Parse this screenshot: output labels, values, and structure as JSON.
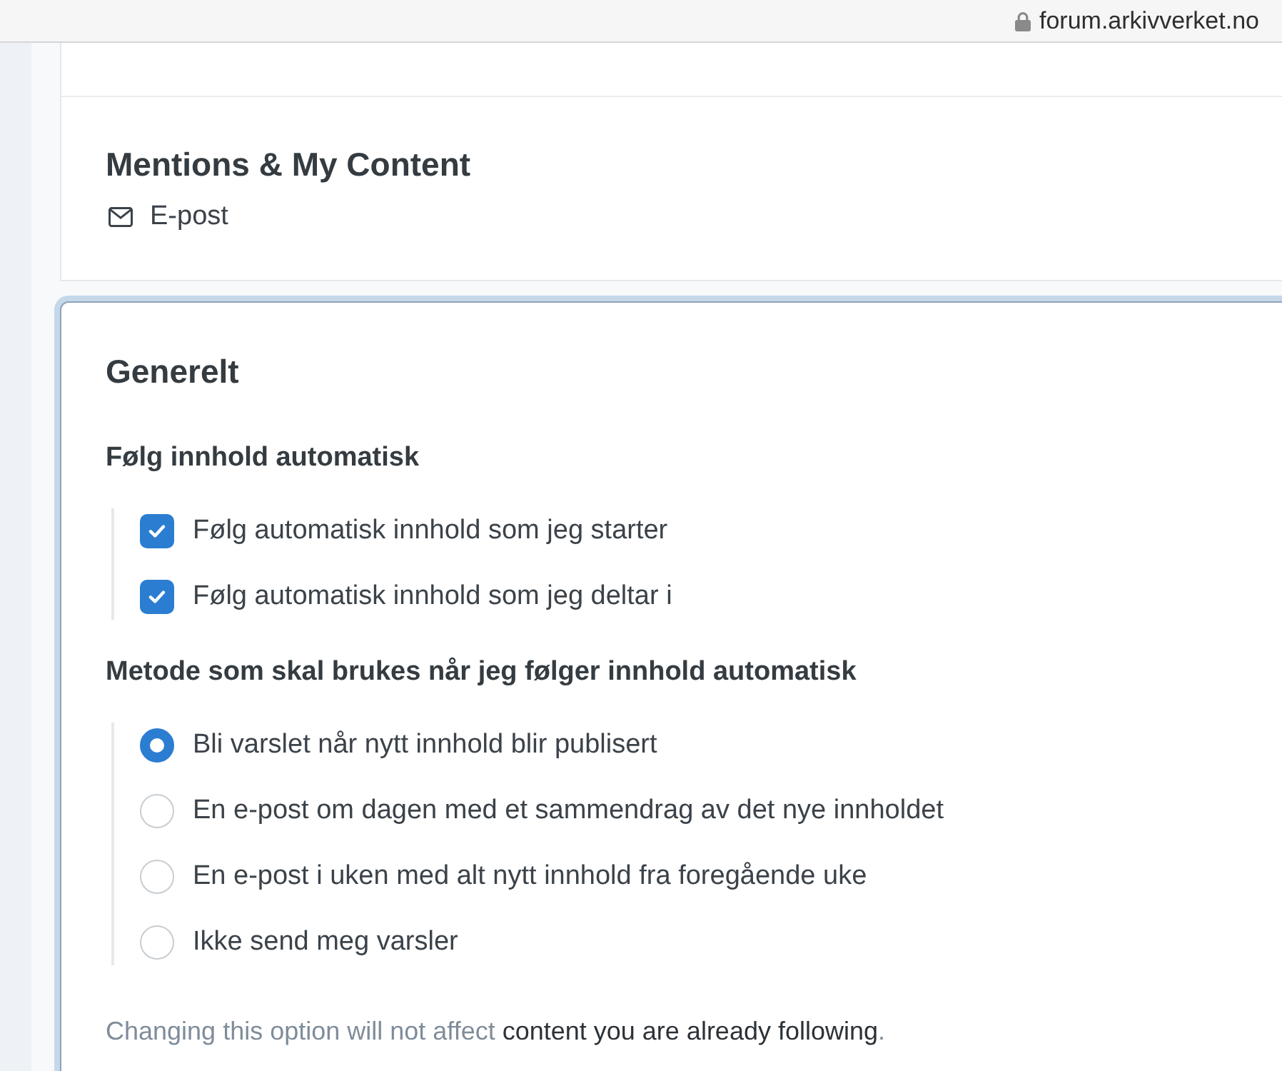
{
  "browser_bar": {
    "url": "forum.arkivverket.no"
  },
  "notification_sections": [
    {
      "title": "Mentions & My Content",
      "methods": [
        {
          "label": "E-post"
        }
      ]
    }
  ],
  "general": {
    "title": "Generelt",
    "groups": [
      {
        "kind": "checkbox",
        "title": "Følg innhold automatisk",
        "options": [
          {
            "label": "Følg automatisk innhold som jeg starter",
            "checked": true
          },
          {
            "label": "Følg automatisk innhold som jeg deltar i",
            "checked": true
          }
        ]
      },
      {
        "kind": "radio",
        "title": "Metode som skal brukes når jeg følger innhold automatisk",
        "options": [
          {
            "label": "Bli varslet når nytt innhold blir publisert",
            "selected": true
          },
          {
            "label": "En e-post om dagen med et sammendrag av det nye innholdet",
            "selected": false
          },
          {
            "label": "En e-post i uken med alt nytt innhold fra foregående uke",
            "selected": false
          },
          {
            "label": "Ikke send meg varsler",
            "selected": false
          }
        ]
      }
    ],
    "note": {
      "text": "Changing this option will not affect",
      "link": "content you are already following",
      "end": "."
    }
  }
}
